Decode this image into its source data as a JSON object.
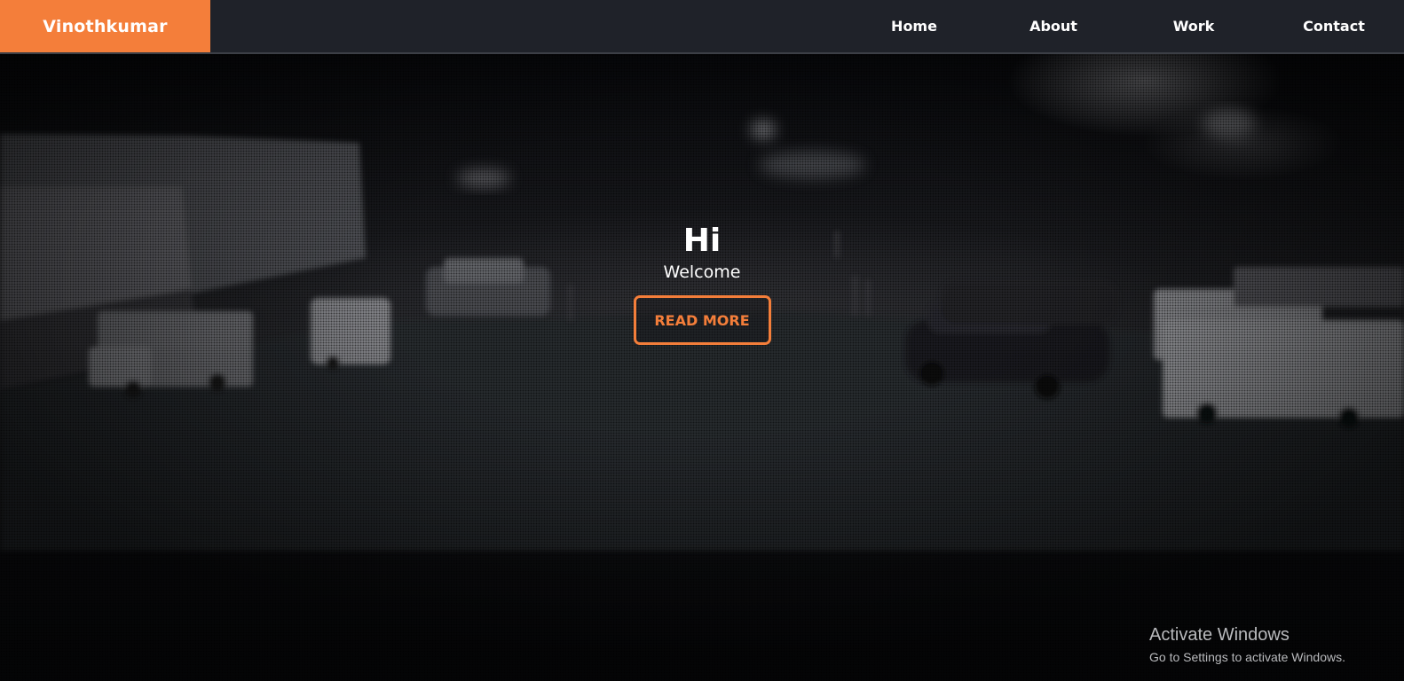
{
  "brand": {
    "name": "Vinothkumar"
  },
  "nav": {
    "items": [
      {
        "label": "Home"
      },
      {
        "label": "About"
      },
      {
        "label": "Work"
      },
      {
        "label": "Contact"
      }
    ]
  },
  "hero": {
    "title": "Hi",
    "subtitle": "Welcome",
    "cta_label": "READ MORE"
  },
  "watermark": {
    "title": "Activate Windows",
    "subtitle": "Go to Settings to activate Windows."
  },
  "colors": {
    "accent": "#f47e3a",
    "navbar": "#1f2229",
    "text": "#ffffff"
  }
}
